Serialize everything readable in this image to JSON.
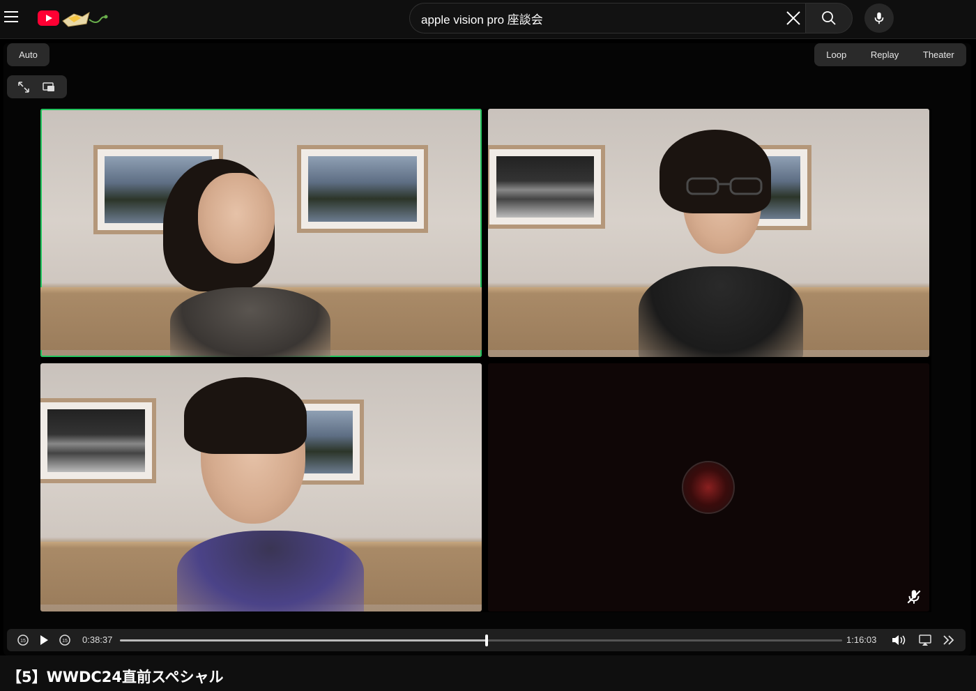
{
  "search": {
    "query": "apple vision pro 座談会",
    "placeholder": "Search"
  },
  "player_toolbar": {
    "auto_label": "Auto",
    "loop_label": "Loop",
    "replay_label": "Replay",
    "theater_label": "Theater"
  },
  "playback": {
    "current_time": "0:38:37",
    "duration": "1:16:03",
    "progress": 0.508
  },
  "video": {
    "title": "【5】WWDC24直前スペシャル"
  },
  "colors": {
    "active_speaker": "#22c55e",
    "youtube_red": "#ff0033"
  }
}
